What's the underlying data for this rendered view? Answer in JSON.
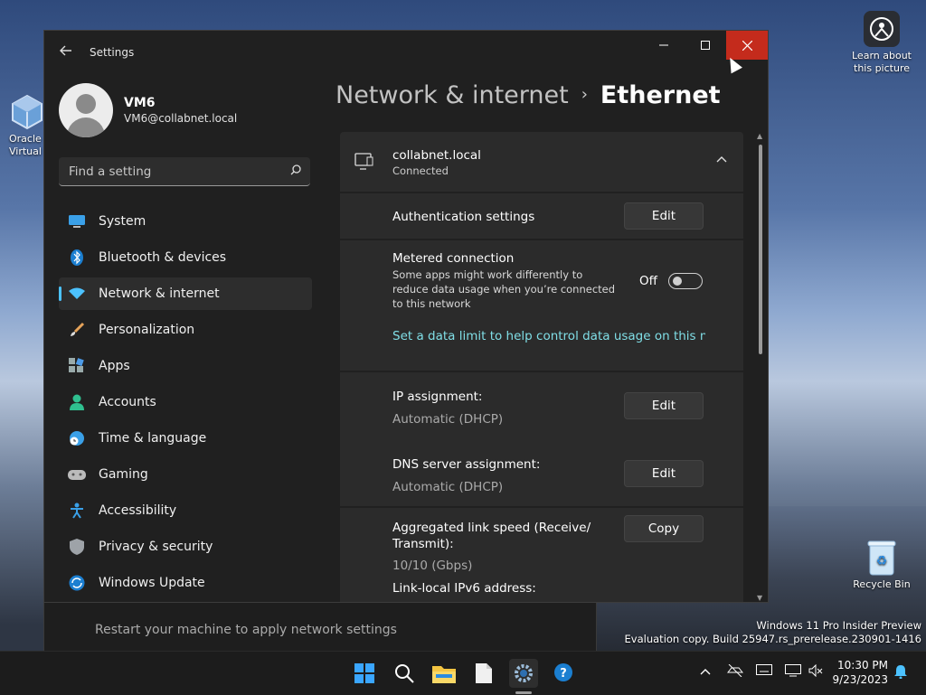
{
  "desktop": {
    "icons": [
      {
        "label": "Oracle VM VirtualBox",
        "short": "Oracle\nVirtual"
      },
      {
        "label": "Learn about this picture"
      },
      {
        "label": "Recycle Bin"
      }
    ],
    "watermark": {
      "line1": "Windows 11 Pro Insider Preview",
      "line2": "Evaluation copy. Build 25947.rs_prerelease.230901-1416"
    }
  },
  "background_window": {
    "text": "Restart your machine to apply network settings"
  },
  "window": {
    "title": "Settings",
    "back_icon": "arrow-left-icon",
    "controls": {
      "minimize": "minimize-icon",
      "maximize": "maximize-icon",
      "close": "close-icon"
    }
  },
  "profile": {
    "name": "VM6",
    "email": "VM6@collabnet.local"
  },
  "search": {
    "placeholder": "Find a setting"
  },
  "sidebar": {
    "items": [
      {
        "label": "System",
        "icon": "monitor-icon",
        "active": false
      },
      {
        "label": "Bluetooth & devices",
        "icon": "bluetooth-icon",
        "active": false
      },
      {
        "label": "Network & internet",
        "icon": "wifi-icon",
        "active": true
      },
      {
        "label": "Personalization",
        "icon": "brush-icon",
        "active": false
      },
      {
        "label": "Apps",
        "icon": "apps-icon",
        "active": false
      },
      {
        "label": "Accounts",
        "icon": "person-icon",
        "active": false
      },
      {
        "label": "Time & language",
        "icon": "globe-clock-icon",
        "active": false
      },
      {
        "label": "Gaming",
        "icon": "gamepad-icon",
        "active": false
      },
      {
        "label": "Accessibility",
        "icon": "accessibility-icon",
        "active": false
      },
      {
        "label": "Privacy & security",
        "icon": "shield-icon",
        "active": false
      },
      {
        "label": "Windows Update",
        "icon": "update-icon",
        "active": false
      }
    ]
  },
  "breadcrumb": {
    "parent": "Network & internet",
    "current": "Ethernet"
  },
  "adapter": {
    "name": "collabnet.local",
    "status": "Connected"
  },
  "settings": {
    "auth_label": "Authentication settings",
    "auth_button": "Edit",
    "metered_label": "Metered connection",
    "metered_desc": "Some apps might work differently to reduce data usage when you’re connected to this network",
    "metered_state": "Off",
    "metered_on": false,
    "data_limit_link": "Set a data limit to help control data usage on this network",
    "ip_label": "IP assignment:",
    "ip_value": "Automatic (DHCP)",
    "ip_button": "Edit",
    "dns_label": "DNS server assignment:",
    "dns_value": "Automatic (DHCP)",
    "dns_button": "Edit",
    "link_speed_label": "Aggregated link speed (Receive/ Transmit):",
    "link_speed_value": "10/10 (Gbps)",
    "copy_button": "Copy",
    "ipv6_label": "Link-local IPv6 address:"
  },
  "taskbar": {
    "apps": [
      "start-icon",
      "search-icon",
      "file-explorer-icon",
      "notepad-icon",
      "settings-icon",
      "get-help-icon"
    ],
    "tray": [
      "chevron-up-icon",
      "network-offline-icon",
      "keyboard-icon",
      "display-icon",
      "speaker-muted-icon",
      "bell-icon"
    ],
    "time": "10:30 PM",
    "date": "9/23/2023"
  },
  "colors": {
    "accent": "#4cc2ff",
    "close": "#c42b1c",
    "link": "#80dfe7"
  }
}
